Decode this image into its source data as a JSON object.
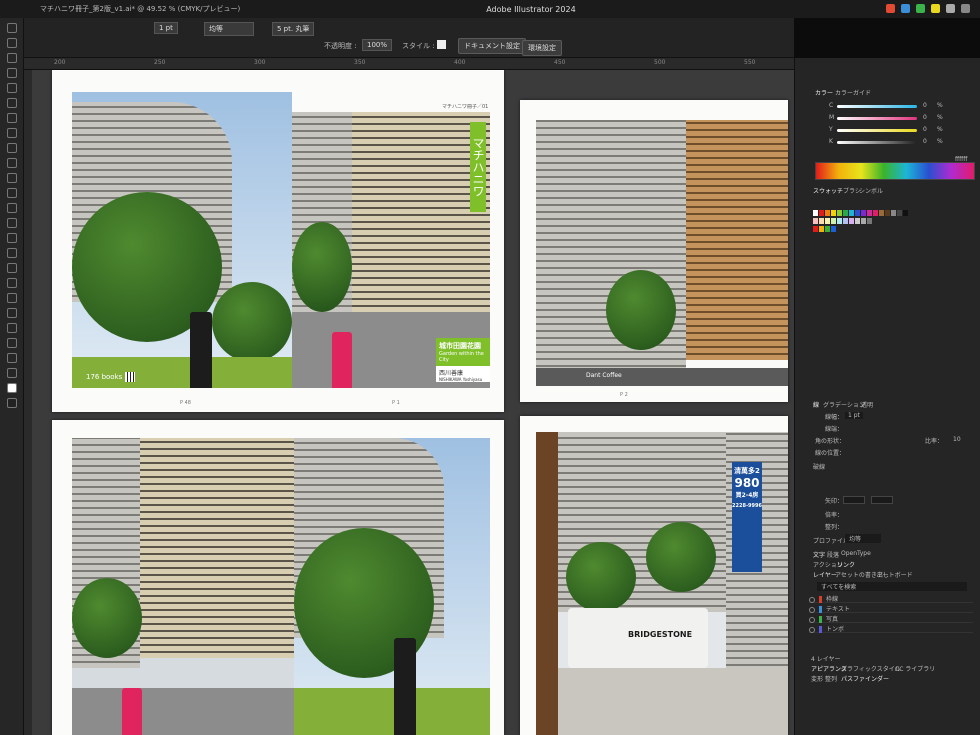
{
  "menubar": {
    "doc_tab": "マチハニワ冊子_第2版_v1.ai* @ 49.52 % (CMYK/プレビュー)",
    "app_title": "Adobe Illustrator 2024"
  },
  "controlbar": {
    "stroke_weight": "1 pt",
    "stroke_profile": "均等",
    "brush": "5 pt. 丸筆",
    "opacity_label": "不透明度 :",
    "opacity_value": "100%",
    "style_label": "スタイル :",
    "doc_settings": "ドキュメント設定",
    "preferences": "環境設定"
  },
  "ruler": {
    "marks": [
      "200",
      "250",
      "300",
      "350",
      "400",
      "450",
      "500",
      "550"
    ]
  },
  "pages": {
    "p1": {
      "runhead": "マチハニワ冊子／01",
      "title": "マチハニワ",
      "cover_jp": "城市田園花園",
      "cover_en": "Garden within the City",
      "author": "西川善康",
      "author_en": "NISHIKAWA Yoshiyasu",
      "books_tag": "176 books",
      "page_left": "P 48",
      "page_right": "P 1"
    },
    "p2": {
      "page": "P 2",
      "sign": "Dant Coffee"
    },
    "p4": {
      "billboard_top": "清萬多2",
      "billboard_price": "980",
      "billboard_sub": "買2-4房",
      "billboard_phone": "2228-9996",
      "bus_text": "BRIDGESTONE"
    }
  },
  "panels": {
    "color_tab": "カラー",
    "color_guide_tab": "カラーガイド",
    "cmyk": [
      {
        "ch": "C",
        "val": "0",
        "unit": "%",
        "color": "#2bb5e5"
      },
      {
        "ch": "M",
        "val": "0",
        "unit": "%",
        "color": "#e0337f"
      },
      {
        "ch": "Y",
        "val": "0",
        "unit": "%",
        "color": "#e8d91f"
      },
      {
        "ch": "K",
        "val": "0",
        "unit": "%",
        "color": "#d9d9d9"
      }
    ],
    "hex": "ffffff",
    "swatch_tabs": [
      "スウォッチ",
      "ブラシ",
      "シンボル"
    ],
    "stroke_tabs": [
      "線",
      "グラデーション",
      "透明"
    ],
    "stroke_labels": {
      "weight": "線幅：",
      "weight_value": "1 pt",
      "cap": "線端：",
      "corner": "角の形状：",
      "limit": "比率：",
      "limit_value": "10",
      "align": "線の位置：",
      "dashed": "破線",
      "arrow_start": "矢印：",
      "scale": "倍率：",
      "align_arrow": "整列："
    },
    "profile_label": "プロファイル：",
    "profile_value": "均等",
    "text_tabs": [
      "文字",
      "段落",
      "OpenType"
    ],
    "action_tabs": [
      "アクション",
      "リンク"
    ],
    "layer_tabs": [
      "レイヤー",
      "アセットの書き出し",
      "アートボード"
    ],
    "layer_search": "すべてを検索",
    "layers": [
      {
        "name": "枠線",
        "color": "#d8402a"
      },
      {
        "name": "テキスト",
        "color": "#3a8fd8"
      },
      {
        "name": "写真",
        "color": "#3ab34a"
      },
      {
        "name": "トンボ",
        "color": "#5a5ad8"
      }
    ],
    "layer_count": "4 レイヤー",
    "appearance_tab": "アピアランス",
    "graphic_style_tab": "グラフィックスタイル",
    "cc_library_tab": "CC ライブラリ",
    "transform_tabs": [
      "変形",
      "整列"
    ],
    "pathfinder_tab": "パスファインダー"
  }
}
